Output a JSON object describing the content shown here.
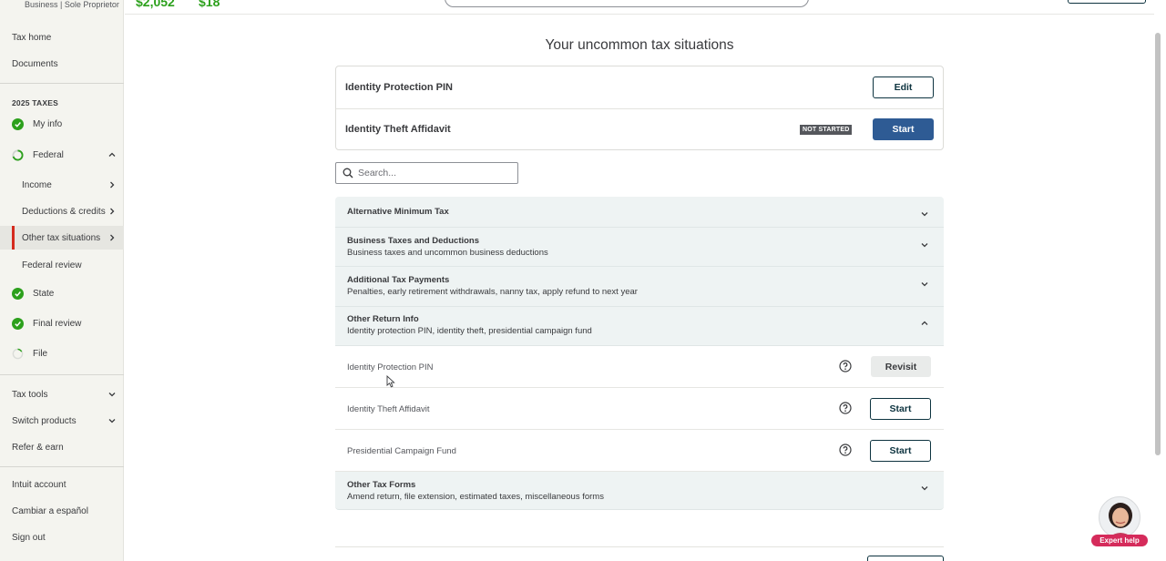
{
  "header": {
    "amount_1": "$2,052",
    "amount_2": "$18"
  },
  "sidebar": {
    "product_subtitle": "Business | Sole Proprietor",
    "tax_home": "Tax home",
    "documents": "Documents",
    "section_label": "2025 TAXES",
    "my_info": "My info",
    "federal": "Federal",
    "income": "Income",
    "deductions": "Deductions & credits",
    "other_tax": "Other tax situations",
    "federal_review": "Federal review",
    "state": "State",
    "final_review": "Final review",
    "file": "File",
    "tax_tools": "Tax tools",
    "switch_products": "Switch products",
    "refer_earn": "Refer & earn",
    "intuit_account": "Intuit account",
    "spanish": "Cambiar a español",
    "sign_out": "Sign out"
  },
  "main": {
    "title": "Your uncommon tax situations",
    "summary": [
      {
        "name": "Identity Protection PIN",
        "button": "Edit"
      },
      {
        "name": "Identity Theft Affidavit",
        "badge": "NOT STARTED",
        "button": "Start"
      }
    ],
    "search_placeholder": "Search...",
    "sections": [
      {
        "title": "Alternative Minimum Tax"
      },
      {
        "title": "Business Taxes and Deductions",
        "desc": "Business taxes and uncommon business deductions"
      },
      {
        "title": "Additional Tax Payments",
        "desc": "Penalties, early retirement withdrawals, nanny tax, apply refund to next year"
      },
      {
        "title": "Other Return Info",
        "desc": "Identity protection PIN, identity theft, presidential campaign fund"
      },
      {
        "title": "Other Tax Forms",
        "desc": "Amend return, file extension, estimated taxes, miscellaneous forms"
      }
    ],
    "rows": [
      {
        "label": "Identity Protection PIN",
        "button": "Revisit"
      },
      {
        "label": "Identity Theft Affidavit",
        "button": "Start"
      },
      {
        "label": "Presidential Campaign Fund",
        "button": "Start"
      }
    ]
  },
  "expert_help": "Expert help",
  "colors": {
    "green": "#2ca01c",
    "accent_red": "#d52b1e",
    "primary_blue": "#2e5b94",
    "dark_teal": "#0d333f",
    "section_bg": "#eef3f3"
  }
}
